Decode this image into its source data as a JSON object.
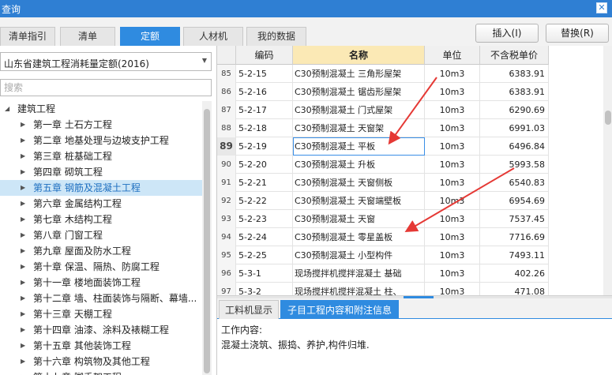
{
  "window": {
    "title": "查询",
    "close_icon": "close-icon"
  },
  "tabs": [
    {
      "label": "清单指引",
      "active": false
    },
    {
      "label": "清单",
      "active": false
    },
    {
      "label": "定额",
      "active": true
    },
    {
      "label": "人材机",
      "active": false
    },
    {
      "label": "我的数据",
      "active": false
    }
  ],
  "buttons": {
    "insert": "插入(I)",
    "replace": "替换(R)"
  },
  "library": {
    "selected": "山东省建筑工程消耗量定额(2016)"
  },
  "search": {
    "placeholder": "搜索",
    "value": ""
  },
  "tree": {
    "root": "建筑工程",
    "items": [
      "第一章 土石方工程",
      "第二章 地基处理与边坡支护工程",
      "第三章 桩基础工程",
      "第四章 砌筑工程",
      "第五章 钢筋及混凝土工程",
      "第六章 金属结构工程",
      "第七章 木结构工程",
      "第八章 门窗工程",
      "第九章 屋面及防水工程",
      "第十章 保温、隔热、防腐工程",
      "第十一章 楼地面装饰工程",
      "第十二章 墙、柱面装饰与隔断、幕墙...",
      "第十三章 天棚工程",
      "第十四章 油漆、涂料及裱糊工程",
      "第十五章 其他装饰工程",
      "第十六章 构筑物及其他工程",
      "第十七章 脚手架工程"
    ],
    "selected_index": 4
  },
  "table": {
    "headers": {
      "no": "",
      "code": "编码",
      "name": "名称",
      "unit": "单位",
      "price": "不含税单价"
    },
    "rows": [
      {
        "no": "85",
        "code": "5-2-15",
        "name": "C30预制混凝土 三角形屋架",
        "unit": "10m3",
        "price": "6383.91"
      },
      {
        "no": "86",
        "code": "5-2-16",
        "name": "C30预制混凝土 锯齿形屋架",
        "unit": "10m3",
        "price": "6383.91"
      },
      {
        "no": "87",
        "code": "5-2-17",
        "name": "C30预制混凝土 门式屋架",
        "unit": "10m3",
        "price": "6290.69"
      },
      {
        "no": "88",
        "code": "5-2-18",
        "name": "C30预制混凝土 天窗架",
        "unit": "10m3",
        "price": "6991.03"
      },
      {
        "no": "89",
        "code": "5-2-19",
        "name": "C30预制混凝土 平板",
        "unit": "10m3",
        "price": "6496.84"
      },
      {
        "no": "90",
        "code": "5-2-20",
        "name": "C30预制混凝土 升板",
        "unit": "10m3",
        "price": "5993.58"
      },
      {
        "no": "91",
        "code": "5-2-21",
        "name": "C30预制混凝土 天窗侧板",
        "unit": "10m3",
        "price": "6540.83"
      },
      {
        "no": "92",
        "code": "5-2-22",
        "name": "C30预制混凝土 天窗端壁板",
        "unit": "10m3",
        "price": "6954.69"
      },
      {
        "no": "93",
        "code": "5-2-23",
        "name": "C30预制混凝土 天窗",
        "unit": "10m3",
        "price": "7537.45"
      },
      {
        "no": "94",
        "code": "5-2-24",
        "name": "C30预制混凝土 零星盖板",
        "unit": "10m3",
        "price": "7716.69"
      },
      {
        "no": "95",
        "code": "5-2-25",
        "name": "C30预制混凝土 小型构件",
        "unit": "10m3",
        "price": "7493.11"
      },
      {
        "no": "96",
        "code": "5-3-1",
        "name": "现场搅拌机搅拌混凝土 基础",
        "unit": "10m3",
        "price": "402.26"
      },
      {
        "no": "97",
        "code": "5-3-2",
        "name": "现场搅拌机搅拌混凝土 柱、",
        "unit": "10m3",
        "price": "471.08"
      }
    ],
    "current_index": 4
  },
  "subtabs": [
    {
      "label": "工料机显示",
      "active": false
    },
    {
      "label": "子目工程内容和附注信息",
      "active": true
    }
  ],
  "detail": {
    "title": "工作内容:",
    "text": "混凝土浇筑、振捣、养护,构件归堆."
  },
  "colors": {
    "accent": "#2f8be0",
    "title_bar": "#2f7fd3",
    "header_highlight": "#fbe9b5",
    "annotation_arrow": "#e53935"
  }
}
